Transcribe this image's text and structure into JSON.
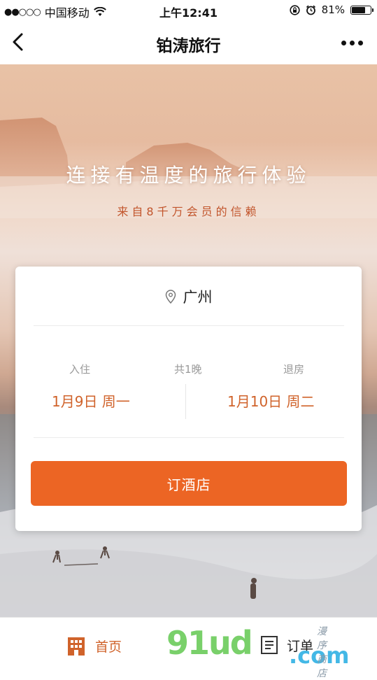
{
  "status_bar": {
    "signal": "●●○○○",
    "carrier": "中国移动",
    "time": "上午12:41",
    "battery": "81%",
    "battery_level": 0.81
  },
  "nav": {
    "title": "铂涛旅行"
  },
  "hero": {
    "title": "连接有温度的旅行体验",
    "subtitle": "来自8千万会员的信赖"
  },
  "booking": {
    "city": "广州",
    "checkin_label": "入住",
    "checkin_date": "1月9日 周一",
    "nights": "共1晚",
    "checkout_label": "退房",
    "checkout_date": "1月10日 周二",
    "book_button": "订酒店"
  },
  "tabs": [
    {
      "label": "首页",
      "icon": "hotel-building-icon",
      "active": true
    },
    {
      "label": "订单",
      "icon": "order-list-icon",
      "active": false
    }
  ],
  "watermark": {
    "main": "91ud",
    "suffix": ".com",
    "script": "漫序商店"
  },
  "colors": {
    "accent": "#ec6524",
    "accent_text": "#d0632b",
    "subtitle": "#c2552c"
  }
}
